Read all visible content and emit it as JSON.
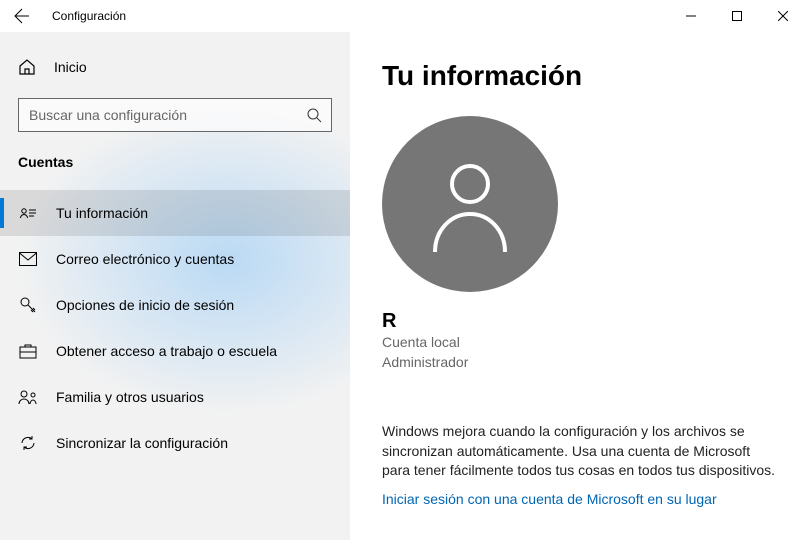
{
  "titlebar": {
    "title": "Configuración"
  },
  "sidebar": {
    "home": "Inicio",
    "search_placeholder": "Buscar una configuración",
    "category": "Cuentas",
    "items": [
      {
        "label": "Tu información"
      },
      {
        "label": "Correo electrónico y cuentas"
      },
      {
        "label": "Opciones de inicio de sesión"
      },
      {
        "label": "Obtener acceso a trabajo o escuela"
      },
      {
        "label": "Familia y otros usuarios"
      },
      {
        "label": "Sincronizar la configuración"
      }
    ]
  },
  "main": {
    "heading": "Tu información",
    "username": "R",
    "account_type": "Cuenta local",
    "role": "Administrador",
    "description": "Windows mejora cuando la configuración y los archivos se sincronizan automáticamente. Usa una cuenta de Microsoft para tener fácilmente todos tus cosas en todos tus dispositivos.",
    "link": "Iniciar sesión con una cuenta de Microsoft en su lugar"
  }
}
